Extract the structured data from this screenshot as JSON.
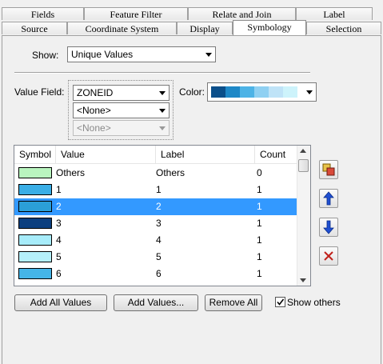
{
  "tabs_back": [
    "Fields",
    "Feature Filter",
    "Relate and Join",
    "Label"
  ],
  "tabs_front": [
    "Source",
    "Coordinate System",
    "Display",
    "Symbology",
    "Selection"
  ],
  "show": {
    "label": "Show:",
    "value": "Unique Values"
  },
  "value_field": {
    "label": "Value Field:",
    "field1": "ZONEID",
    "field2": "<None>",
    "field3": "<None>"
  },
  "color": {
    "label": "Color:",
    "ramp": [
      "#0b4f8a",
      "#1e88c7",
      "#4db3e6",
      "#8fd0f2",
      "#bfe3f7",
      "#cdf3fb"
    ]
  },
  "table": {
    "headers": [
      "Symbol",
      "Value",
      "Label",
      "Count"
    ],
    "rows": [
      {
        "value": "Others",
        "label": "Others",
        "count": "0",
        "color": "#b9f5bf",
        "selected": false
      },
      {
        "value": "1",
        "label": "1",
        "count": "1",
        "color": "#3aaee6",
        "selected": false
      },
      {
        "value": "2",
        "label": "2",
        "count": "1",
        "color": "#2b9fd8",
        "selected": true
      },
      {
        "value": "3",
        "label": "3",
        "count": "1",
        "color": "#0b3f7f",
        "selected": false
      },
      {
        "value": "4",
        "label": "4",
        "count": "1",
        "color": "#a7ecfa",
        "selected": false
      },
      {
        "value": "5",
        "label": "5",
        "count": "1",
        "color": "#b5f0fb",
        "selected": false
      },
      {
        "value": "6",
        "label": "6",
        "count": "1",
        "color": "#45b5e8",
        "selected": false
      }
    ]
  },
  "buttons": {
    "add_all": "Add All Values",
    "add_values": "Add Values...",
    "remove_all": "Remove All"
  },
  "show_others": {
    "label": "Show others",
    "checked": true
  }
}
